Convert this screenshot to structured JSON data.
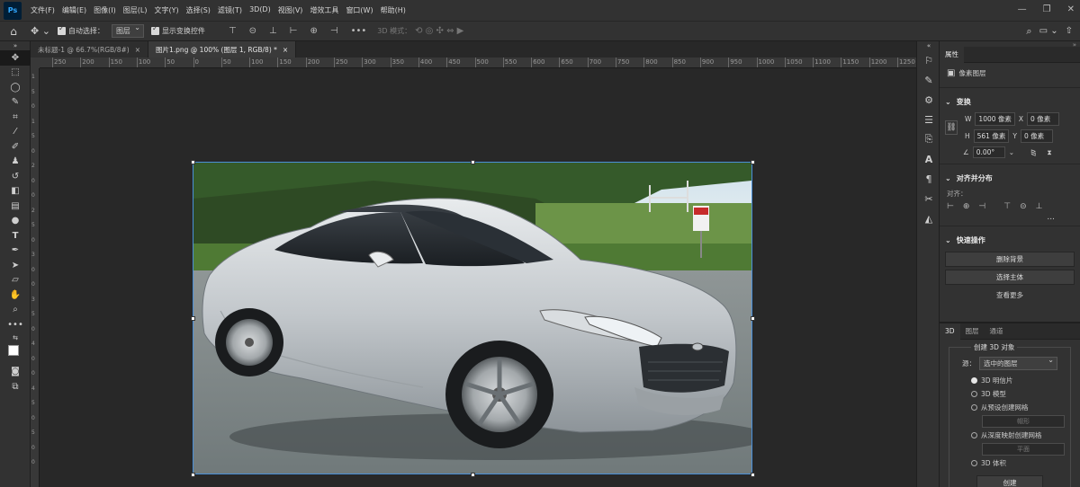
{
  "app": {
    "logo": "Ps"
  },
  "menu": [
    "文件(F)",
    "编辑(E)",
    "图像(I)",
    "图层(L)",
    "文字(Y)",
    "选择(S)",
    "滤镜(T)",
    "3D(D)",
    "视图(V)",
    "增效工具",
    "窗口(W)",
    "帮助(H)"
  ],
  "options": {
    "auto_select_label": "自动选择：",
    "auto_select_value": "图层",
    "show_transform_label": "显示变换控件",
    "mode_label": "3D 模式："
  },
  "tabs": [
    {
      "label": "未标题-1 @ 66.7%(RGB/8#)",
      "close": "×"
    },
    {
      "label": "图片1.png @ 100% (图层 1, RGB/8) *",
      "close": "×"
    }
  ],
  "ruler_h": [
    "250",
    "200",
    "150",
    "100",
    "50",
    "0",
    "50",
    "100",
    "150",
    "200",
    "250",
    "300",
    "350",
    "400",
    "450",
    "500",
    "550",
    "600",
    "650",
    "700",
    "750",
    "800",
    "850",
    "900",
    "950",
    "1000",
    "1050",
    "1100",
    "1150",
    "1200",
    "1250"
  ],
  "ruler_v": [
    "1",
    "5",
    "0",
    "1",
    "5",
    "0",
    "2",
    "0",
    "0",
    "2",
    "5",
    "0",
    "3",
    "0",
    "0",
    "3",
    "5",
    "0",
    "4",
    "0",
    "0",
    "4",
    "5",
    "0",
    "5",
    "0",
    "0"
  ],
  "properties": {
    "tab_label": "属性",
    "layer_type": "像素图层",
    "transform_title": "变换",
    "w_label": "W",
    "w_value": "1000 像素",
    "x_label": "X",
    "x_value": "0 像素",
    "h_label": "H",
    "h_value": "561 像素",
    "y_label": "Y",
    "y_value": "0 像素",
    "angle_value": "0.00°",
    "align_title": "对齐并分布",
    "align_label": "对齐：",
    "more": "...",
    "quick_title": "快速操作",
    "remove_bg": "删除背景",
    "select_subject": "选择主体",
    "view_more": "查看更多"
  },
  "panel3d": {
    "tabs": [
      "3D",
      "图层",
      "通道"
    ],
    "create_title": "创建 3D 对象",
    "source_label": "源：",
    "source_value": "选中的图层",
    "opt_postcard": "3D 明信片",
    "opt_model": "3D 模型",
    "opt_preset_mesh": "从预设创建网格",
    "sub_preset": "帽形",
    "opt_depth_mesh": "从深度映射创建网格",
    "sub_depth": "平面",
    "opt_volume": "3D 体积",
    "create_button": "创建"
  },
  "colors": {
    "accent": "#31a8ff",
    "selection": "#4a8fd8"
  }
}
